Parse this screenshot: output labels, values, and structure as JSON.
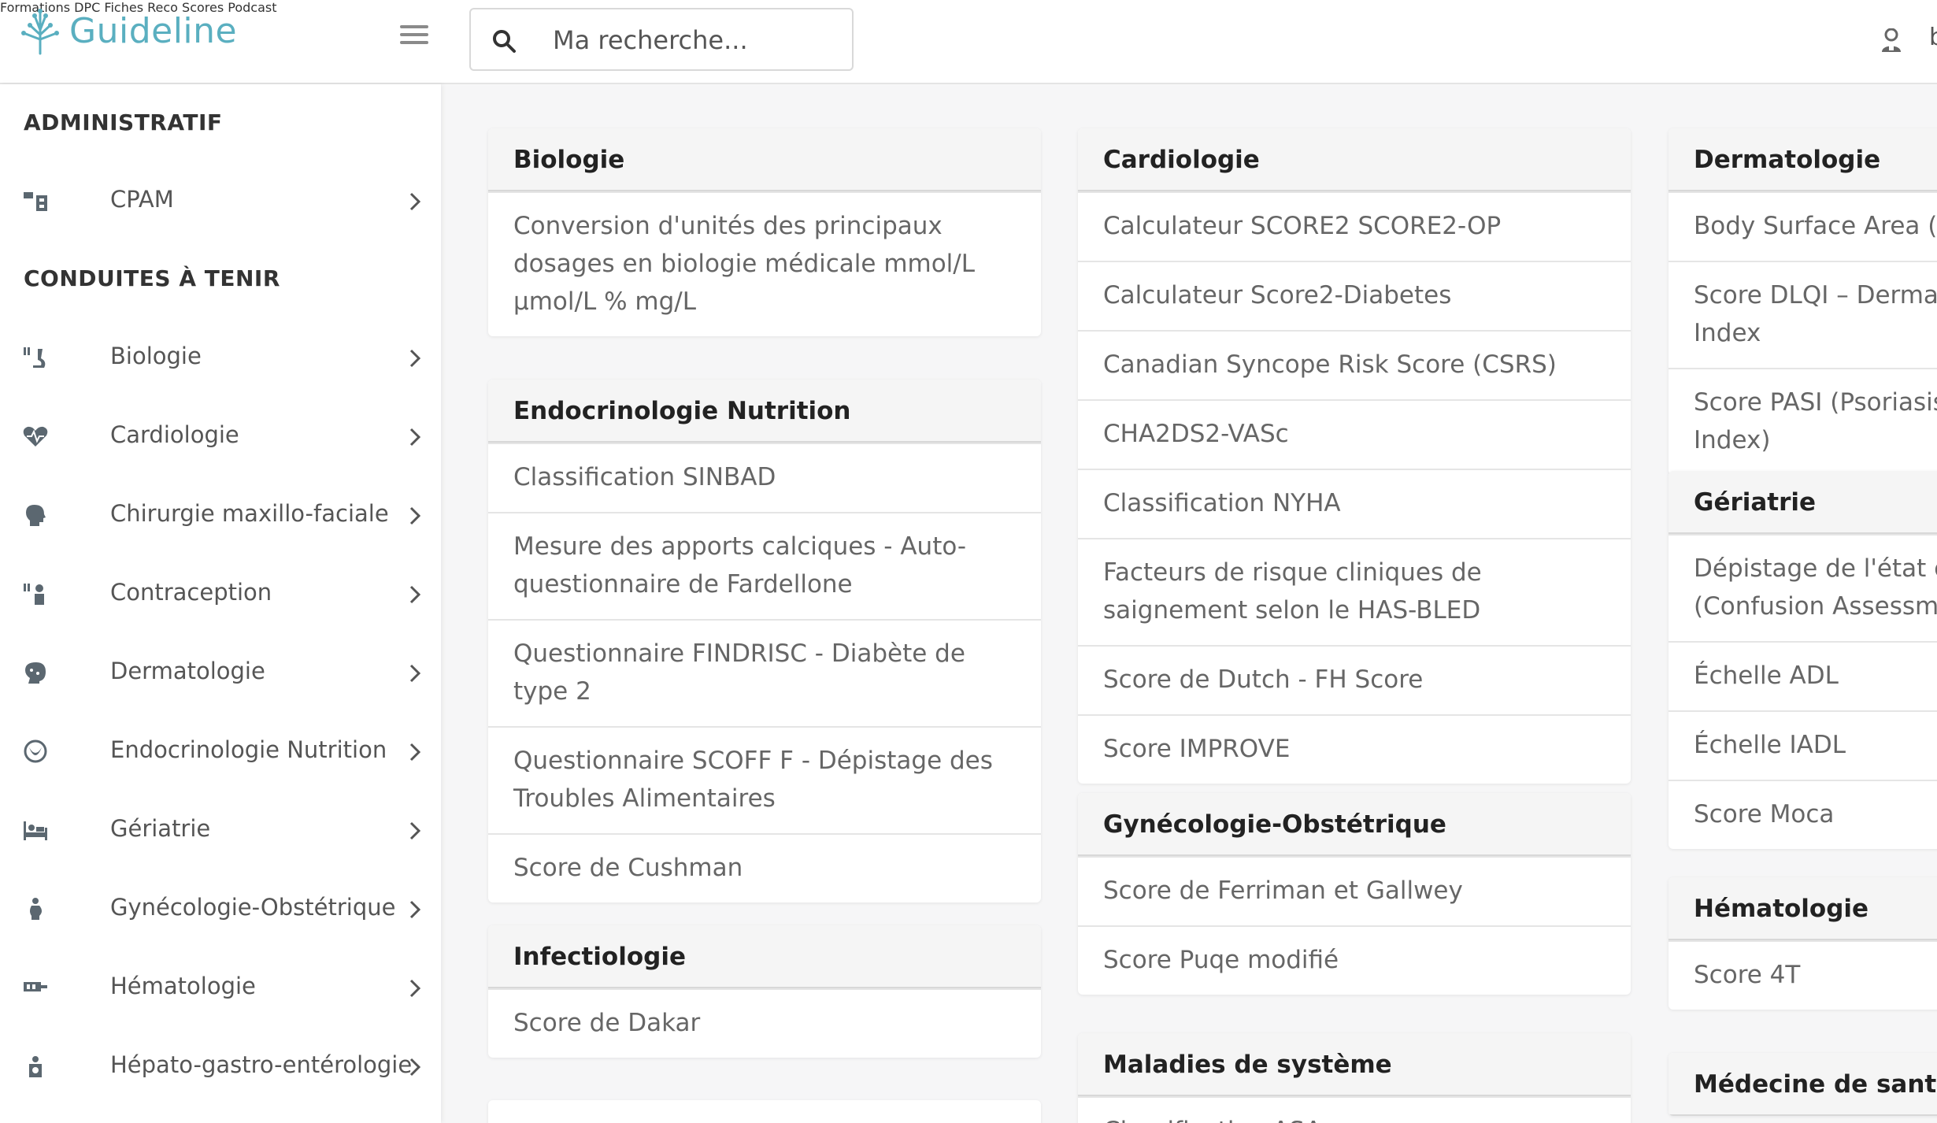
{
  "header": {
    "logo_text": "Guideline",
    "search_placeholder": "Ma recherche...",
    "nav": [
      "Formations DPC",
      "Fiches Reco",
      "Scores",
      "Podcast"
    ],
    "user_initial": "b"
  },
  "sidebar": {
    "sections": [
      {
        "heading": "ADMINISTRATIF",
        "items": [
          {
            "label": "CPAM",
            "icon": "cpam-icon"
          }
        ]
      },
      {
        "heading": "CONDUITES À TENIR",
        "items": [
          {
            "label": "Biologie",
            "icon": "microscope-icon"
          },
          {
            "label": "Cardiologie",
            "icon": "heart-pulse-icon"
          },
          {
            "label": "Chirurgie maxillo-faciale",
            "icon": "head-icon"
          },
          {
            "label": "Contraception",
            "icon": "contraception-icon"
          },
          {
            "label": "Dermatologie",
            "icon": "face-icon"
          },
          {
            "label": "Endocrinologie Nutrition",
            "icon": "gland-icon"
          },
          {
            "label": "Gériatrie",
            "icon": "bed-icon"
          },
          {
            "label": "Gynécologie-Obstétrique",
            "icon": "pregnant-icon"
          },
          {
            "label": "Hématologie",
            "icon": "blood-icon"
          },
          {
            "label": "Hépato-gastro-entérologie",
            "icon": "liver-icon"
          }
        ]
      }
    ]
  },
  "cards": {
    "biologie": {
      "title": "Biologie",
      "items": [
        "Conversion d'unités des principaux dosages en biologie médicale mmol/L µmol/L % mg/L"
      ]
    },
    "endocrinologie": {
      "title": "Endocrinologie Nutrition",
      "items": [
        "Classification SINBAD",
        "Mesure des apports calciques - Auto-questionnaire de Fardellone",
        "Questionnaire FINDRISC - Diabète de type 2",
        "Questionnaire SCOFF F - Dépistage des Troubles Alimentaires",
        "Score de Cushman"
      ]
    },
    "infectiologie": {
      "title": "Infectiologie",
      "items": [
        "Score de Dakar"
      ]
    },
    "cardiologie": {
      "title": "Cardiologie",
      "items": [
        "Calculateur SCORE2 SCORE2-OP",
        "Calculateur Score2-Diabetes",
        "Canadian Syncope Risk Score (CSRS)",
        "CHA2DS2-VASc",
        "Classification NYHA",
        "Facteurs de risque cliniques de saignement selon le HAS-BLED",
        "Score de Dutch - FH Score",
        "Score IMPROVE"
      ]
    },
    "gynecologie": {
      "title": "Gynécologie-Obstétrique",
      "items": [
        "Score de Ferriman et Gallwey",
        "Score Puqe modifié"
      ]
    },
    "maladies": {
      "title": "Maladies de système",
      "items": [
        "Classification ASA"
      ]
    },
    "dermatologie": {
      "title": "Dermatologie",
      "items": [
        "Body Surface Area (BSA)",
        "Score DLQI – Dermatology Life Quality Index",
        "Score PASI (Psoriasis Area and Severity Index)"
      ]
    },
    "geriatrie": {
      "title": "Gériatrie",
      "items": [
        "Dépistage de l'état confusionnel : CAM (Confusion Assessment Method)",
        "Échelle ADL",
        "Échelle IADL",
        "Score Moca"
      ]
    },
    "hematologie": {
      "title": "Hématologie",
      "items": [
        "Score 4T"
      ]
    },
    "medecine": {
      "title": "Médecine de santé",
      "items": []
    }
  },
  "colors": {
    "brand": "#5aafc0",
    "icon": "#5b6770",
    "text": "#555555"
  }
}
